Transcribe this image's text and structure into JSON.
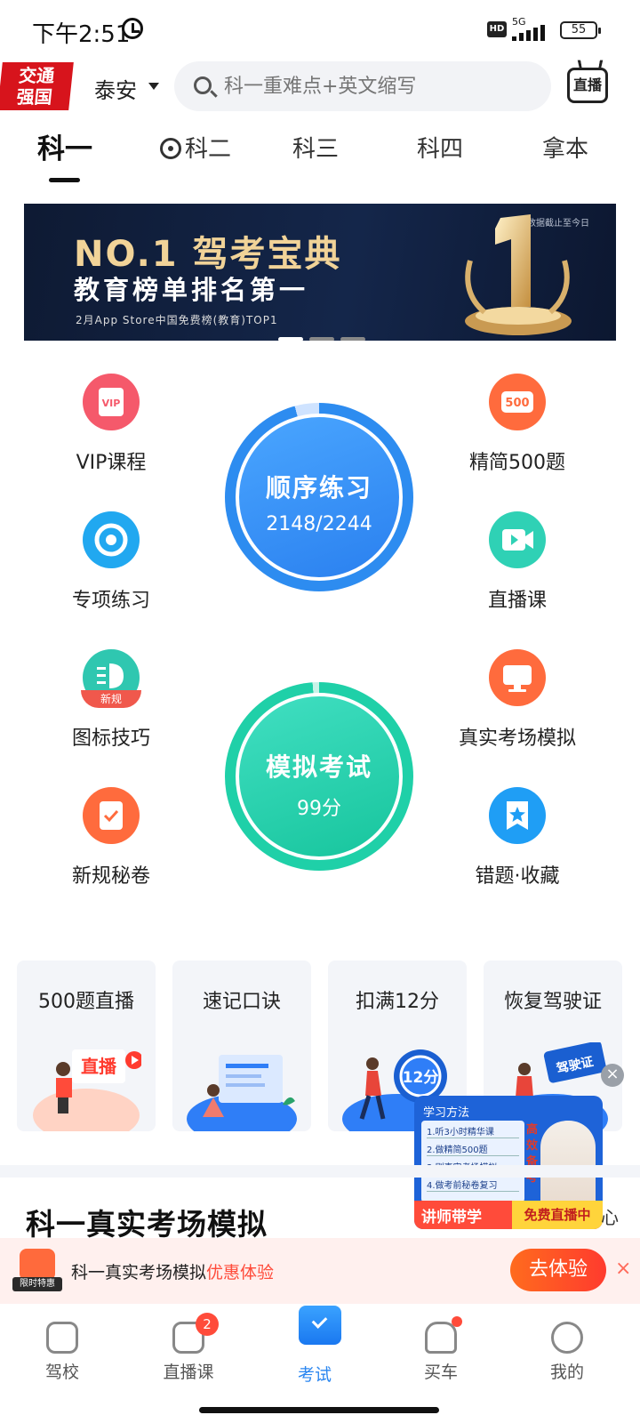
{
  "status": {
    "time": "下午2:51",
    "hd": "HD",
    "network": "5G",
    "battery": "55"
  },
  "header": {
    "logo": "交通\n强国",
    "city": "泰安",
    "search_placeholder": "科一重难点+英文缩写",
    "live_label": "直播"
  },
  "tabs": [
    {
      "label": "科一",
      "active": true
    },
    {
      "label": "科二"
    },
    {
      "label": "科三"
    },
    {
      "label": "科四"
    },
    {
      "label": "拿本"
    }
  ],
  "banner": {
    "headline": "NO.1 驾考宝典",
    "subline": "教育榜单排名第一",
    "footnote": "2月App Store中国免费榜(教育)TOP1",
    "note": "数据截止至今日"
  },
  "grid_left": [
    {
      "label": "VIP课程",
      "icon": "vip-icon",
      "color": "#f5596b"
    },
    {
      "label": "专项练习",
      "icon": "target-icon",
      "color": "#21a8f0"
    },
    {
      "label": "图标技巧",
      "icon": "headlight-icon",
      "color": "#2fc7b0",
      "badge": "新规"
    },
    {
      "label": "新规秘卷",
      "icon": "clipboard-icon",
      "color": "#ff6b3d"
    }
  ],
  "grid_right": [
    {
      "label": "精简500题",
      "icon": "500-icon",
      "color": "#ff6b3d"
    },
    {
      "label": "直播课",
      "icon": "video-icon",
      "color": "#2fd1b5"
    },
    {
      "label": "真实考场模拟",
      "icon": "monitor-icon",
      "color": "#ff6b3d"
    },
    {
      "label": "错题·收藏",
      "icon": "star-bookmark-icon",
      "color": "#1f9ef5"
    }
  ],
  "practice": {
    "title": "顺序练习",
    "progress": "2148/2244",
    "fraction": 0.957
  },
  "exam": {
    "title": "模拟考试",
    "score": "99分",
    "fraction": 0.99
  },
  "cards": [
    {
      "title": "500题直播",
      "tag": "直播"
    },
    {
      "title": "速记口诀"
    },
    {
      "title": "扣满12分",
      "tag": "12分"
    },
    {
      "title": "恢复驾驶证",
      "tag": "驾驶证"
    }
  ],
  "floating_promo": {
    "title": "学习方法",
    "steps": [
      "1.听3小时精华课",
      "2.做精简500题",
      "3.刷真实考场模拟",
      "4.做考前秘卷复习"
    ],
    "side": "高效备考",
    "left_label": "讲师带学",
    "right_label": "免费直播中",
    "peek_text": "心"
  },
  "section": {
    "title": "科一真实考场模拟"
  },
  "promo_bar": {
    "gift_tag": "限时特惠",
    "text": "科一真实考场模拟",
    "highlight": "优惠体验",
    "button": "去体验",
    "close": "×"
  },
  "nav": [
    {
      "label": "驾校"
    },
    {
      "label": "直播课",
      "badge": "2"
    },
    {
      "label": "考试",
      "active": true
    },
    {
      "label": "买车",
      "dot": true
    },
    {
      "label": "我的"
    }
  ],
  "colors": {
    "accent": "#2a86f0",
    "promo": "#ff4b3a",
    "practice_ring": "#2d8cf0",
    "exam_ring": "#1fd0a8"
  }
}
